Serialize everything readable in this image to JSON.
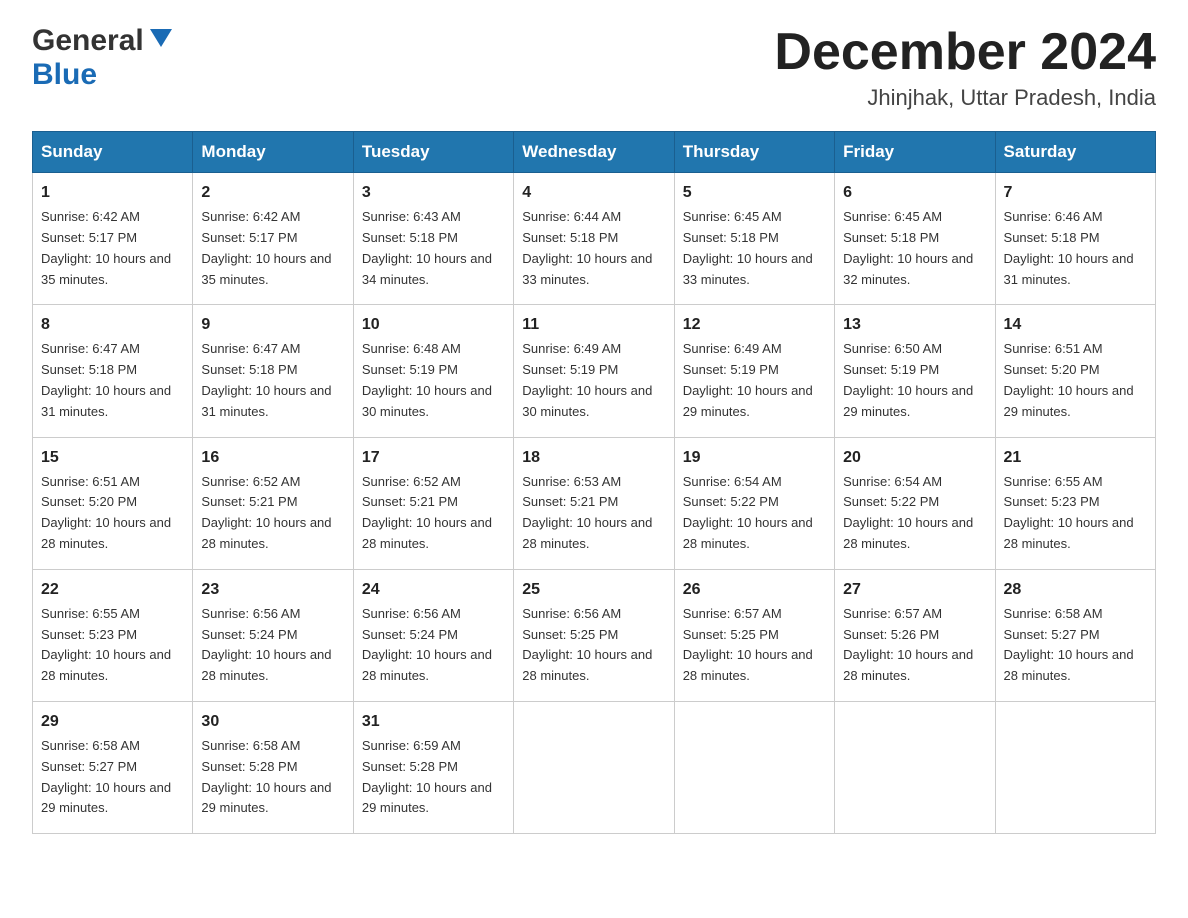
{
  "header": {
    "month_title": "December 2024",
    "location": "Jhinjhak, Uttar Pradesh, India",
    "logo_general": "General",
    "logo_blue": "Blue"
  },
  "weekdays": [
    "Sunday",
    "Monday",
    "Tuesday",
    "Wednesday",
    "Thursday",
    "Friday",
    "Saturday"
  ],
  "weeks": [
    [
      {
        "day": "1",
        "sunrise": "6:42 AM",
        "sunset": "5:17 PM",
        "daylight": "10 hours and 35 minutes."
      },
      {
        "day": "2",
        "sunrise": "6:42 AM",
        "sunset": "5:17 PM",
        "daylight": "10 hours and 35 minutes."
      },
      {
        "day": "3",
        "sunrise": "6:43 AM",
        "sunset": "5:18 PM",
        "daylight": "10 hours and 34 minutes."
      },
      {
        "day": "4",
        "sunrise": "6:44 AM",
        "sunset": "5:18 PM",
        "daylight": "10 hours and 33 minutes."
      },
      {
        "day": "5",
        "sunrise": "6:45 AM",
        "sunset": "5:18 PM",
        "daylight": "10 hours and 33 minutes."
      },
      {
        "day": "6",
        "sunrise": "6:45 AM",
        "sunset": "5:18 PM",
        "daylight": "10 hours and 32 minutes."
      },
      {
        "day": "7",
        "sunrise": "6:46 AM",
        "sunset": "5:18 PM",
        "daylight": "10 hours and 31 minutes."
      }
    ],
    [
      {
        "day": "8",
        "sunrise": "6:47 AM",
        "sunset": "5:18 PM",
        "daylight": "10 hours and 31 minutes."
      },
      {
        "day": "9",
        "sunrise": "6:47 AM",
        "sunset": "5:18 PM",
        "daylight": "10 hours and 31 minutes."
      },
      {
        "day": "10",
        "sunrise": "6:48 AM",
        "sunset": "5:19 PM",
        "daylight": "10 hours and 30 minutes."
      },
      {
        "day": "11",
        "sunrise": "6:49 AM",
        "sunset": "5:19 PM",
        "daylight": "10 hours and 30 minutes."
      },
      {
        "day": "12",
        "sunrise": "6:49 AM",
        "sunset": "5:19 PM",
        "daylight": "10 hours and 29 minutes."
      },
      {
        "day": "13",
        "sunrise": "6:50 AM",
        "sunset": "5:19 PM",
        "daylight": "10 hours and 29 minutes."
      },
      {
        "day": "14",
        "sunrise": "6:51 AM",
        "sunset": "5:20 PM",
        "daylight": "10 hours and 29 minutes."
      }
    ],
    [
      {
        "day": "15",
        "sunrise": "6:51 AM",
        "sunset": "5:20 PM",
        "daylight": "10 hours and 28 minutes."
      },
      {
        "day": "16",
        "sunrise": "6:52 AM",
        "sunset": "5:21 PM",
        "daylight": "10 hours and 28 minutes."
      },
      {
        "day": "17",
        "sunrise": "6:52 AM",
        "sunset": "5:21 PM",
        "daylight": "10 hours and 28 minutes."
      },
      {
        "day": "18",
        "sunrise": "6:53 AM",
        "sunset": "5:21 PM",
        "daylight": "10 hours and 28 minutes."
      },
      {
        "day": "19",
        "sunrise": "6:54 AM",
        "sunset": "5:22 PM",
        "daylight": "10 hours and 28 minutes."
      },
      {
        "day": "20",
        "sunrise": "6:54 AM",
        "sunset": "5:22 PM",
        "daylight": "10 hours and 28 minutes."
      },
      {
        "day": "21",
        "sunrise": "6:55 AM",
        "sunset": "5:23 PM",
        "daylight": "10 hours and 28 minutes."
      }
    ],
    [
      {
        "day": "22",
        "sunrise": "6:55 AM",
        "sunset": "5:23 PM",
        "daylight": "10 hours and 28 minutes."
      },
      {
        "day": "23",
        "sunrise": "6:56 AM",
        "sunset": "5:24 PM",
        "daylight": "10 hours and 28 minutes."
      },
      {
        "day": "24",
        "sunrise": "6:56 AM",
        "sunset": "5:24 PM",
        "daylight": "10 hours and 28 minutes."
      },
      {
        "day": "25",
        "sunrise": "6:56 AM",
        "sunset": "5:25 PM",
        "daylight": "10 hours and 28 minutes."
      },
      {
        "day": "26",
        "sunrise": "6:57 AM",
        "sunset": "5:25 PM",
        "daylight": "10 hours and 28 minutes."
      },
      {
        "day": "27",
        "sunrise": "6:57 AM",
        "sunset": "5:26 PM",
        "daylight": "10 hours and 28 minutes."
      },
      {
        "day": "28",
        "sunrise": "6:58 AM",
        "sunset": "5:27 PM",
        "daylight": "10 hours and 28 minutes."
      }
    ],
    [
      {
        "day": "29",
        "sunrise": "6:58 AM",
        "sunset": "5:27 PM",
        "daylight": "10 hours and 29 minutes."
      },
      {
        "day": "30",
        "sunrise": "6:58 AM",
        "sunset": "5:28 PM",
        "daylight": "10 hours and 29 minutes."
      },
      {
        "day": "31",
        "sunrise": "6:59 AM",
        "sunset": "5:28 PM",
        "daylight": "10 hours and 29 minutes."
      },
      null,
      null,
      null,
      null
    ]
  ]
}
